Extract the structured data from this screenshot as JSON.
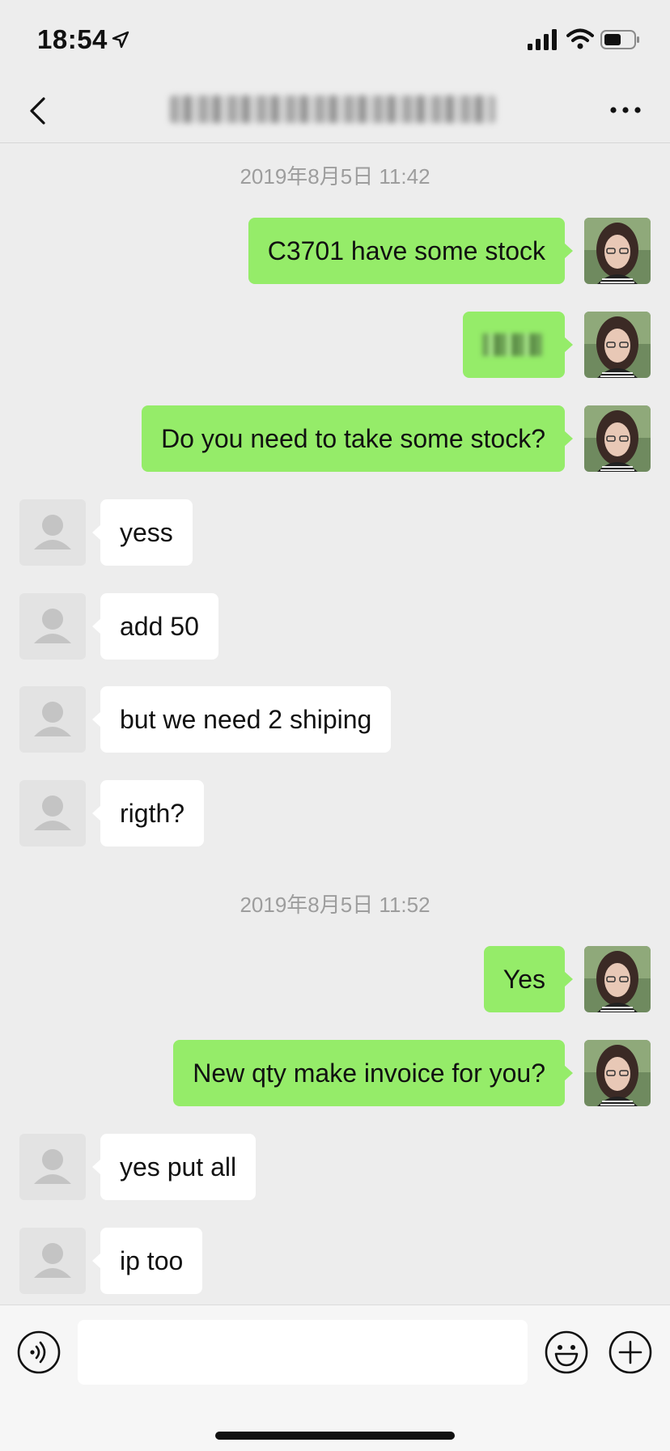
{
  "status_bar": {
    "time": "18:54",
    "icons": [
      "location-arrow-icon",
      "cellular-signal-icon",
      "wifi-icon",
      "battery-icon"
    ]
  },
  "nav": {
    "back_icon": "chevron-left-icon",
    "title": "",
    "more_icon": "ellipsis-icon"
  },
  "chat": {
    "timestamps": [
      "2019年8月5日 11:42",
      "2019年8月5日 11:52"
    ],
    "messages": [
      {
        "sender": "me",
        "text": "C3701 have some stock"
      },
      {
        "sender": "me",
        "text": ""
      },
      {
        "sender": "me",
        "text": "Do you need to take some stock?"
      },
      {
        "sender": "other",
        "text": "yess"
      },
      {
        "sender": "other",
        "text": "add 50"
      },
      {
        "sender": "other",
        "text": "but we need 2 shiping"
      },
      {
        "sender": "other",
        "text": "rigth?"
      },
      {
        "sender": "me",
        "text": "Yes"
      },
      {
        "sender": "me",
        "text": "New qty make invoice for you?"
      },
      {
        "sender": "other",
        "text": "yes put all"
      },
      {
        "sender": "other",
        "text": "ip too"
      }
    ]
  },
  "input_bar": {
    "voice_icon": "voice-input-icon",
    "input_value": "",
    "emoji_icon": "emoji-icon",
    "plus_icon": "plus-circle-icon"
  },
  "colors": {
    "background": "#ededed",
    "my_bubble": "#95ec69",
    "their_bubble": "#ffffff",
    "timestamp_text": "#9d9d9d"
  }
}
